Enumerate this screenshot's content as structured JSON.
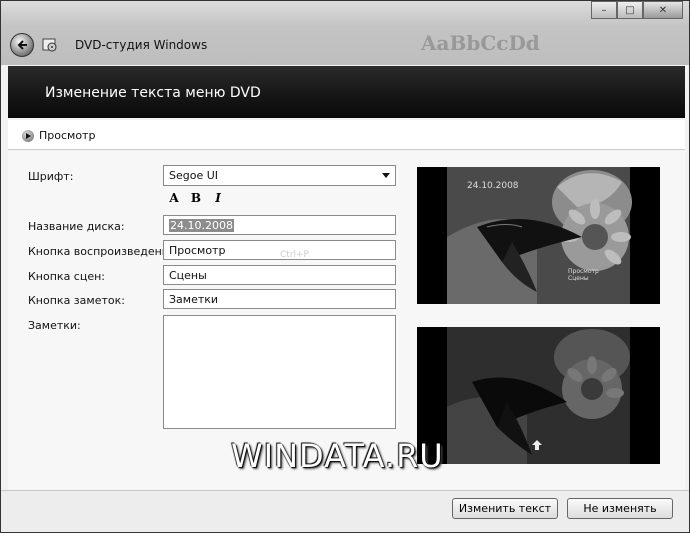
{
  "window": {
    "app_title": "DVD-студия Windows",
    "controls": {
      "minimize": "–",
      "maximize": "□",
      "close": "✕"
    },
    "background_text_sample": "AaBbCcDd"
  },
  "header": {
    "title": "Изменение текста меню DVD"
  },
  "preview": {
    "label": "Просмотр"
  },
  "form": {
    "font_label": "Шрифт:",
    "font_value": "Segoe UI",
    "style_bold_a": "A",
    "style_bold_b": "B",
    "style_italic": "I",
    "disc_title_label": "Название диска:",
    "disc_title_value": "24.10.2008",
    "play_button_label": "Кнопка воспроизведения:",
    "play_button_value": "Просмотр",
    "scenes_button_label": "Кнопка сцен:",
    "scenes_button_value": "Сцены",
    "notes_button_label": "Кнопка заметок:",
    "notes_button_value": "Заметки",
    "notes_label": "Заметки:",
    "notes_value": "",
    "shortcut_hint": "Ctrl+P"
  },
  "thumbnails": {
    "date_text": "24.10.2008",
    "menu_item_1": "Просмотр",
    "menu_item_2": "Сцены"
  },
  "watermark": "WINDATA.RU",
  "footer": {
    "ok_label": "Изменить текст",
    "cancel_label": "Не изменять"
  }
}
